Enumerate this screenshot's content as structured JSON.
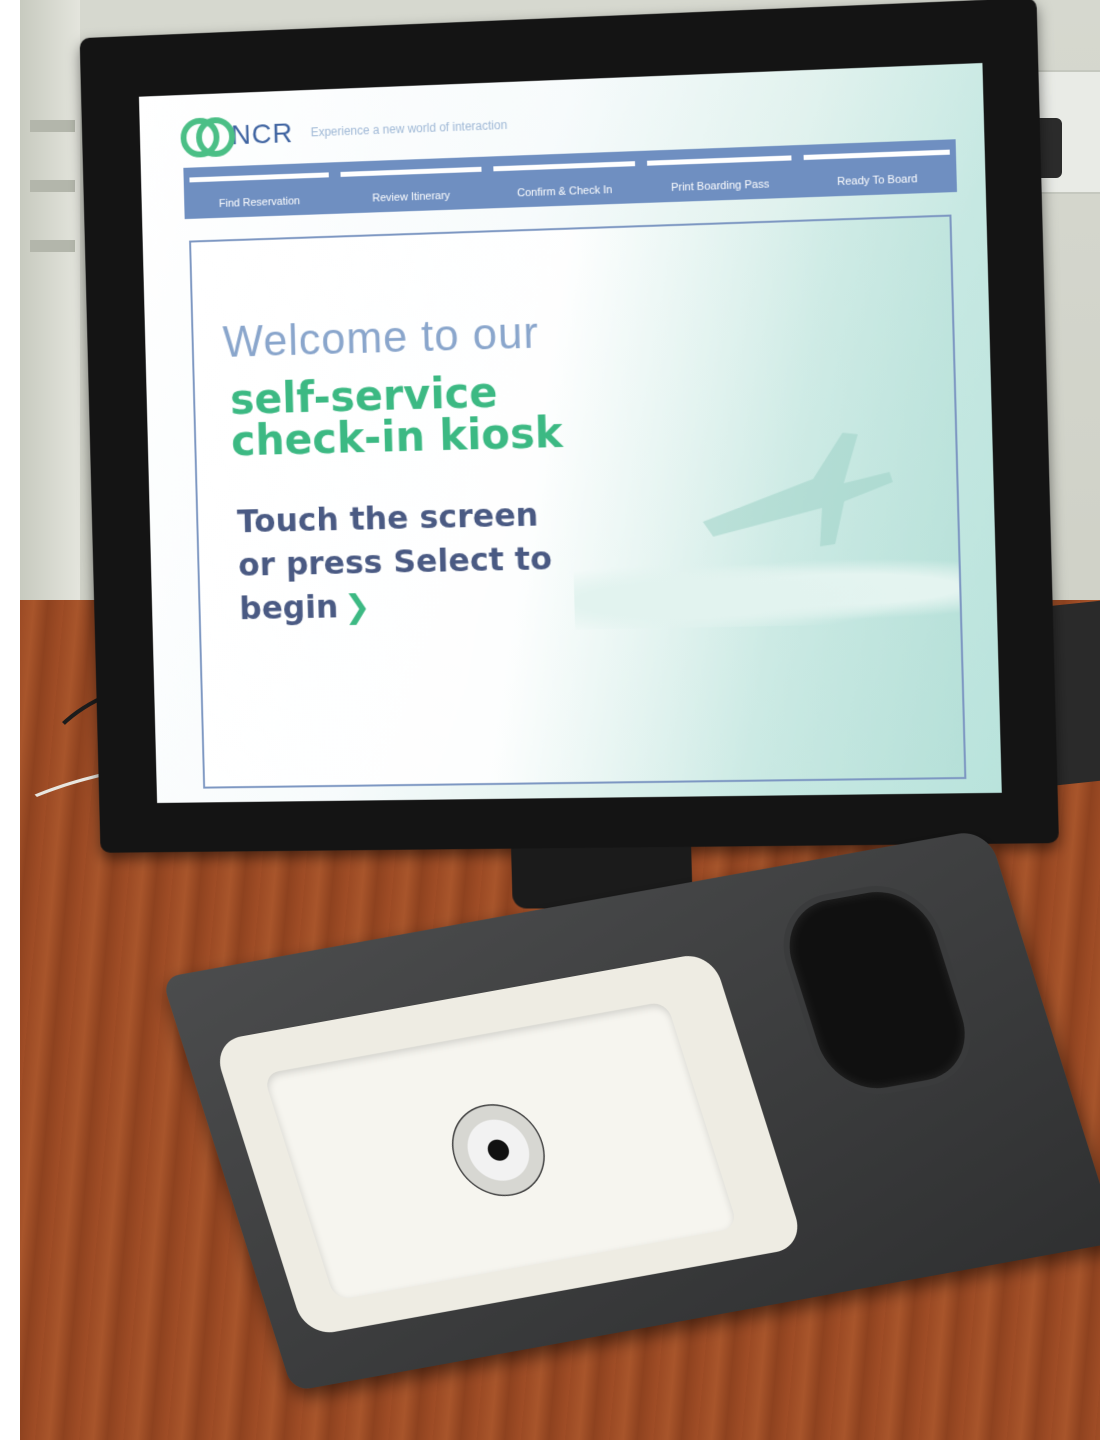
{
  "kiosk": {
    "brand": "NCR",
    "tagline": "Experience a new world of interaction",
    "steps": [
      {
        "label": "Find Reservation"
      },
      {
        "label": "Review Itinerary"
      },
      {
        "label": "Confirm & Check In"
      },
      {
        "label": "Print Boarding Pass"
      },
      {
        "label": "Ready To Board"
      }
    ],
    "welcome": "Welcome to our",
    "headline_line1": "self-service",
    "headline_line2": "check-in kiosk",
    "prompt_line1": "Touch the screen",
    "prompt_line2": "or press Select to",
    "prompt_line3": "begin",
    "prompt_arrow": "❯"
  },
  "colors": {
    "brand_green": "#3cb983",
    "brand_blue": "#3f64a1",
    "step_bar": "#6f8fc1",
    "prompt_text": "#4a5a83"
  }
}
